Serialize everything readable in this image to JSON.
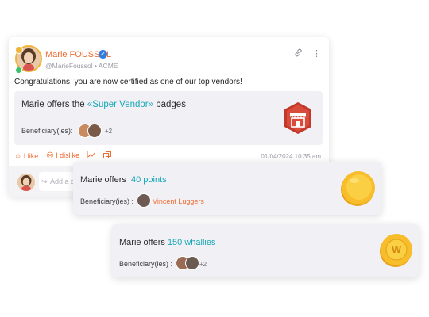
{
  "post": {
    "author": "Marie FOUSSOL",
    "handle": "@MarieFoussol",
    "company": "ACME",
    "message": "Congratulations, you are now certified as one of our top vendors!",
    "badge_offer": {
      "prefix": "Marie offers the ",
      "highlight": "«Super Vendor»",
      "suffix": " badges",
      "beneficiary_label": "Beneficiary(ies):",
      "more": "+2"
    },
    "actions": {
      "like": "I like",
      "dislike": "I dislike"
    },
    "date": "01/04/2024 10:35 am",
    "comment_placeholder": "Add a c"
  },
  "points_offer": {
    "prefix": "Marie offers",
    "highlight": "40 points",
    "beneficiary_label": "Beneficiary(ies) :",
    "beneficiary_name": "Vincent Luggers"
  },
  "whallies_offer": {
    "prefix": "Marie offers",
    "highlight": "150 whallies",
    "beneficiary_label": "Beneficiary(ies) :",
    "more": "+2",
    "coin_letter": "W"
  },
  "colors": {
    "accent_orange": "#ef6c2f",
    "teal": "#1aa7b8",
    "verified_blue": "#2f7de1"
  }
}
